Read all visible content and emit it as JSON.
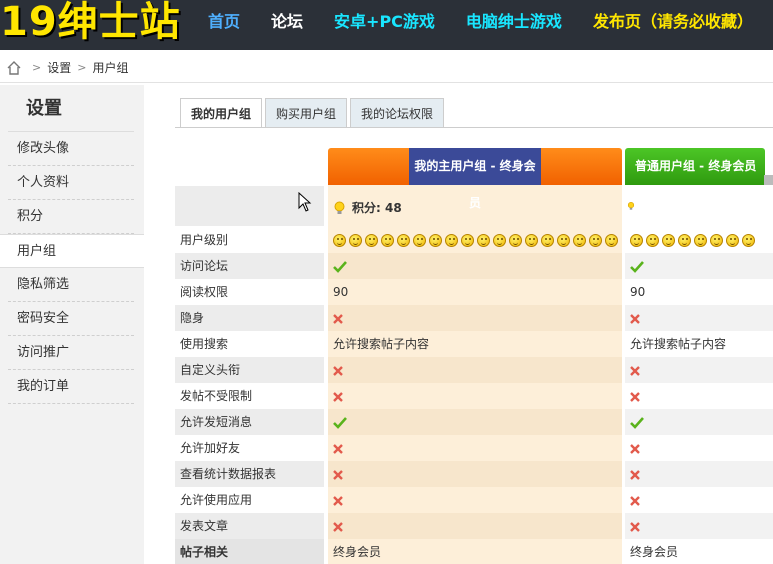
{
  "header": {
    "logo": "19绅士站",
    "nav": [
      {
        "label": "首页",
        "color": "#4fb0ff"
      },
      {
        "label": "论坛",
        "color": "#ffffff"
      },
      {
        "label": "安卓+PC游戏",
        "color": "#19e6ff"
      },
      {
        "label": "电脑绅士游戏",
        "color": "#19e6ff"
      },
      {
        "label": "发布页（请务必收藏）",
        "color": "#ffe600"
      }
    ]
  },
  "breadcrumb": {
    "home_icon": "home-icon",
    "items": [
      "设置",
      "用户组"
    ]
  },
  "sidebar": {
    "title": "设置",
    "items": [
      "修改头像",
      "个人资料",
      "积分",
      "用户组",
      "隐私筛选",
      "密码安全",
      "访问推广",
      "我的订单"
    ],
    "active_index": 3
  },
  "tabs": [
    "我的用户组",
    "购买用户组",
    "我的论坛权限"
  ],
  "groups": {
    "main": {
      "title": "我的主用户组 - 终身会员",
      "score_label": "积分: 48"
    },
    "ordinary": {
      "title": "普通用户组 - 终身会员"
    }
  },
  "rows": [
    {
      "label": "用户级别",
      "c1": {
        "type": "smileys",
        "count": 18
      },
      "c2": {
        "type": "smileys",
        "count": 8
      }
    },
    {
      "label": "访问论坛",
      "c1": {
        "type": "check"
      },
      "c2": {
        "type": "check"
      }
    },
    {
      "label": "阅读权限",
      "c1": {
        "type": "text",
        "text": "90"
      },
      "c2": {
        "type": "text",
        "text": "90"
      }
    },
    {
      "label": "隐身",
      "c1": {
        "type": "cross"
      },
      "c2": {
        "type": "cross"
      }
    },
    {
      "label": "使用搜索",
      "c1": {
        "type": "text",
        "text": "允许搜索帖子内容"
      },
      "c2": {
        "type": "text",
        "text": "允许搜索帖子内容"
      }
    },
    {
      "label": "自定义头衔",
      "c1": {
        "type": "cross"
      },
      "c2": {
        "type": "cross"
      }
    },
    {
      "label": "发帖不受限制",
      "c1": {
        "type": "cross"
      },
      "c2": {
        "type": "cross"
      }
    },
    {
      "label": "允许发短消息",
      "c1": {
        "type": "check"
      },
      "c2": {
        "type": "check"
      }
    },
    {
      "label": "允许加好友",
      "c1": {
        "type": "cross"
      },
      "c2": {
        "type": "cross"
      }
    },
    {
      "label": "查看统计数据报表",
      "c1": {
        "type": "cross"
      },
      "c2": {
        "type": "cross"
      }
    },
    {
      "label": "允许使用应用",
      "c1": {
        "type": "cross"
      },
      "c2": {
        "type": "cross"
      }
    },
    {
      "label": "发表文章",
      "c1": {
        "type": "cross"
      },
      "c2": {
        "type": "cross"
      }
    },
    {
      "label": "帖子相关",
      "c1": {
        "type": "text",
        "text": "终身会员"
      },
      "c2": {
        "type": "text",
        "text": "终身会员"
      }
    }
  ],
  "colors": {
    "header_bg": "#2b3038",
    "logo": "#ffe600",
    "main_group_orange": "#f16100",
    "main_group_label_bg": "#3b4a98",
    "ordinary_group_green": "#3aa816",
    "check_green": "#5ab31c",
    "cross_red": "#e25a4c"
  }
}
